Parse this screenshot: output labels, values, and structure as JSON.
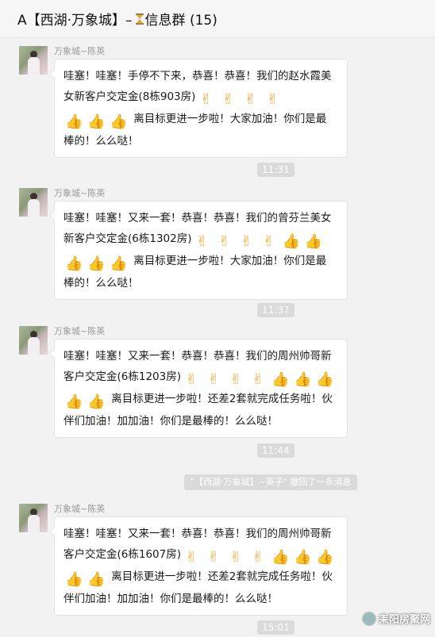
{
  "header": {
    "title_prefix": "A【西湖·万象城】–",
    "title_suffix": "信息群 (15)"
  },
  "messages": [
    {
      "sender": "万象城~陈英",
      "line1": "哇塞！哇塞！手停不下来，恭喜！恭喜！我们的赵水霞美",
      "line2a": "女新客户交定金(8栋903房)",
      "line3b": "离目标更进一步啦！大家加油！你们是最",
      "line4": "棒的！么么哒！"
    },
    {
      "sender": "万象城~陈英",
      "line1": "哇塞！哇塞！又来一套！恭喜！恭喜！我们的曾芬兰美女",
      "line2a": "新客户交定金(6栋1302房)",
      "line3b": "离目标更进一步啦！大家加油！你们是最",
      "line4": "棒的！么么哒！"
    },
    {
      "sender": "万象城~陈英",
      "line1": "哇塞！哇塞！又来一套！恭喜！恭喜！我们的周州帅哥新",
      "line2a": "客户交定金(6栋1203房)",
      "line3b": "离目标更进一步啦！还差2套就完成任务啦！伙",
      "line4": "伴们加油！加加油！你们是最棒的！么么哒！"
    },
    {
      "sender": "万象城~陈英",
      "line1": "哇塞！哇塞！又来一套！恭喜！恭喜！我们的周州帅哥新",
      "line2a": "客户交定金(6栋1607房)",
      "line3b": "离目标更进一步啦！还差2套就完成任务啦！伙",
      "line4": "伴们加油！加加油！你们是最棒的！么么哒！"
    }
  ],
  "timestamps": [
    "11:31",
    "11:37",
    "11:44",
    "15:01"
  ],
  "system_notice": "\"【西湖·万象城】~英子\" 撤回了一条消息",
  "watermark": "耒阳房聚网",
  "icons": {
    "victory": "victory-hand-emoji",
    "thumbs": "thumbs-up-emoji",
    "hourglass": "hourglass-icon"
  }
}
